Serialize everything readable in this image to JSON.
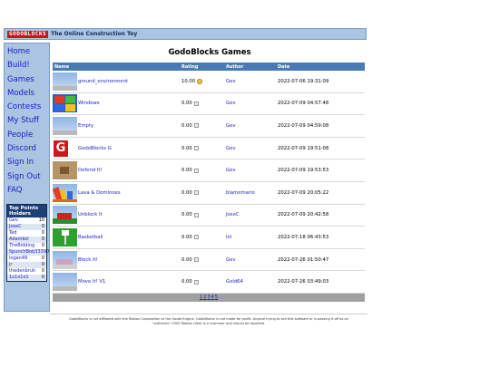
{
  "header": {
    "logo_text": "GODOBLOCKS",
    "tagline": "The Online Construction Toy"
  },
  "nav": [
    {
      "label": "Home"
    },
    {
      "label": "Build!"
    },
    {
      "label": "Games"
    },
    {
      "label": "Models"
    },
    {
      "label": "Contests"
    },
    {
      "label": "My Stuff"
    },
    {
      "label": "People"
    },
    {
      "label": "Discord"
    },
    {
      "label": "Sign In"
    },
    {
      "label": "Sign Out"
    },
    {
      "label": "FAQ"
    }
  ],
  "top_points": {
    "title": "Top Points Holders",
    "rows": [
      {
        "name": "Gev",
        "value": "10"
      },
      {
        "name": "JoseC",
        "value": "0"
      },
      {
        "name": "Ted",
        "value": "0"
      },
      {
        "name": "Adamkol",
        "value": "0"
      },
      {
        "name": "TheBidding",
        "value": "0"
      },
      {
        "name": "SpunchBob3339",
        "value": "0"
      },
      {
        "name": "logan49",
        "value": "0"
      },
      {
        "name": "jr",
        "value": "0"
      },
      {
        "name": "thedenbruh",
        "value": "0"
      },
      {
        "name": "1x1x1x1",
        "value": "0"
      }
    ]
  },
  "main": {
    "title": "GodoBlocks Games",
    "columns": {
      "name": "Name",
      "rating": "Rating",
      "author": "Author",
      "date": "Date"
    },
    "games": [
      {
        "name": "ground_environment",
        "rating": "10.00",
        "author": "Gev",
        "date": "2022-07-06 19:31:09",
        "thumb": "sky-ground",
        "star": true
      },
      {
        "name": "Windows",
        "rating": "0.00",
        "author": "Gev",
        "date": "2022-07-09 04:57:48",
        "thumb": "windows",
        "star": false
      },
      {
        "name": "Empty",
        "rating": "0.00",
        "author": "Gev",
        "date": "2022-07-09 04:59:08",
        "thumb": "sky-ground",
        "star": false
      },
      {
        "name": "GodoBlocks G",
        "rating": "0.00",
        "author": "Gev",
        "date": "2022-07-09 19:51:08",
        "thumb": "logo-g",
        "star": false
      },
      {
        "name": "Defend It!",
        "rating": "0.00",
        "author": "Gev",
        "date": "2022-07-09 19:53:53",
        "thumb": "defend",
        "star": false
      },
      {
        "name": "Lava & Dominoes",
        "rating": "0.00",
        "author": "blamemario",
        "date": "2022-07-09 20:05:22",
        "thumb": "dominoes",
        "star": false
      },
      {
        "name": "Unblock It",
        "rating": "0.00",
        "author": "JoseC",
        "date": "2022-07-09 20:42:58",
        "thumb": "unblock",
        "star": false
      },
      {
        "name": "Basketball",
        "rating": "0.00",
        "author": "lol",
        "date": "2022-07-18 06:43:53",
        "thumb": "basketball",
        "star": false
      },
      {
        "name": "Block It!",
        "rating": "0.00",
        "author": "Gev",
        "date": "2022-07-26 01:50:47",
        "thumb": "blockit",
        "star": false
      },
      {
        "name": "Move It! V1",
        "rating": "0.00",
        "author": "Gold64",
        "date": "2022-07-26 03:49:03",
        "thumb": "sky-ground",
        "star": false
      }
    ],
    "pages": [
      "1",
      "2",
      "3",
      "4",
      "5"
    ]
  },
  "footer": {
    "line1": "GodoBlocks is not affiliated with the Roblox Corporation or the Godot Engine. GodoBlocks is not made for profit. Anyone trying to sell this software or is passing it off as an",
    "line2": "\"authentic\" 2005 Roblox client is a scammer and should be reported."
  },
  "colors": {
    "accent": "#aac4e2",
    "header_blue": "#4a7ab4",
    "link": "#1a1ac8",
    "logo_red": "#c8141c"
  }
}
